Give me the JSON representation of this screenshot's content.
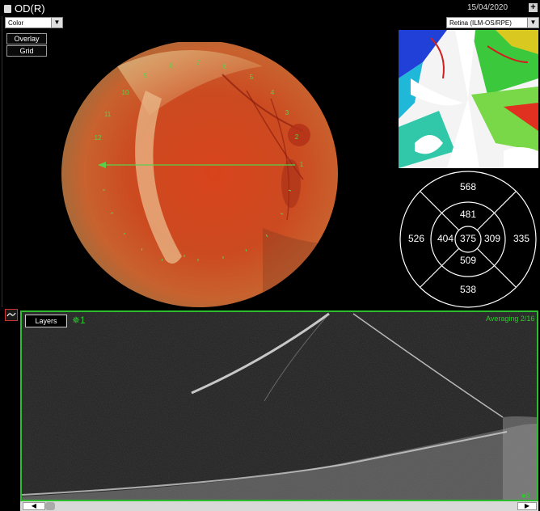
{
  "header": {
    "eye_label": "OD(R)",
    "date": "15/04/2020",
    "plus_label": "+"
  },
  "controls": {
    "color_mode": "Color",
    "layer_select": "Retina (ILM-OS/RPE)",
    "overlay_label": "Overlay",
    "grid_label": "Grid"
  },
  "fundus": {
    "clock_labels": [
      "1",
      "2",
      "3",
      "4",
      "5",
      "6",
      "7",
      "8",
      "9",
      "10",
      "11",
      "12"
    ],
    "scan_line_color": "#5bd04b"
  },
  "etdrs": {
    "center": "375",
    "inner_superior": "481",
    "inner_temporal": "404",
    "inner_nasal": "309",
    "inner_inferior": "509",
    "outer_superior": "568",
    "outer_temporal": "526",
    "outer_nasal": "335",
    "outer_inferior": "538"
  },
  "oct": {
    "layers_label": "Layers",
    "scan_marker": "✵1",
    "averaging": "Averaging 2/16",
    "corner_label": "■8",
    "accent_color": "#2ebd2e"
  },
  "icons": {
    "eye_icon": "document-icon",
    "oct_icon": "oct-scan-icon"
  }
}
